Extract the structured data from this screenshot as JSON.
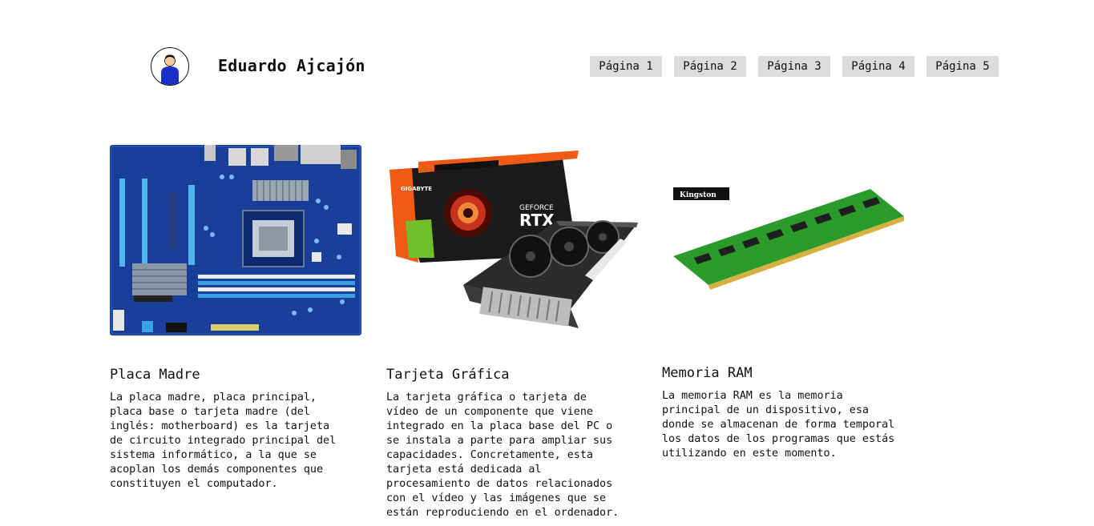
{
  "header": {
    "name": "Eduardo Ajcajón",
    "avatar_icon": "user-avatar-icon"
  },
  "nav": {
    "items": [
      {
        "label": "Página 1"
      },
      {
        "label": "Página 2"
      },
      {
        "label": "Página 3"
      },
      {
        "label": "Página 4"
      },
      {
        "label": "Página 5"
      }
    ]
  },
  "cards": [
    {
      "image_alt": "Placa madre Gigabyte",
      "title": "Placa Madre",
      "text": "La placa madre, placa principal,\nplaca base o tarjeta madre (del\ninglés: motherboard) es la tarjeta\nde circuito integrado principal del\nsistema informático, a la que se\nacoplan los demás componentes que\nconstituyen el computador."
    },
    {
      "image_alt": "Tarjeta gráfica Gigabyte GeForce RTX",
      "box_brand": "GIGABYTE",
      "box_model_line1": "GEFORCE",
      "box_model_line2": "RTX",
      "title": "Tarjeta Gráfica",
      "text": "La tarjeta gráfica o tarjeta de\nvídeo de un componente que viene\nintegrado en la placa base del PC o\nse instala a parte para ampliar sus\ncapacidades. Concretamente, esta\ntarjeta está dedicada al\nprocesamiento de datos relacionados\ncon el vídeo y las imágenes que se\nestán reproduciendo en el ordenador."
    },
    {
      "image_alt": "Memoria RAM Kingston",
      "ram_brand": "Kingston",
      "title": "Memoria RAM",
      "text": "La memoria RAM es la memoria\nprincipal de un dispositivo, esa\ndonde se almacenan de forma temporal\nlos datos de los programas que estás\nutilizando en este momento."
    }
  ],
  "colors": {
    "nav_bg": "#dcdcdc",
    "avatar_blue": "#1c2fc4",
    "motherboard_blue": "#1a3f9a",
    "gpu_orange": "#f05a14",
    "gpu_green": "#6fbf2a",
    "ram_green": "#2a9a2a"
  }
}
